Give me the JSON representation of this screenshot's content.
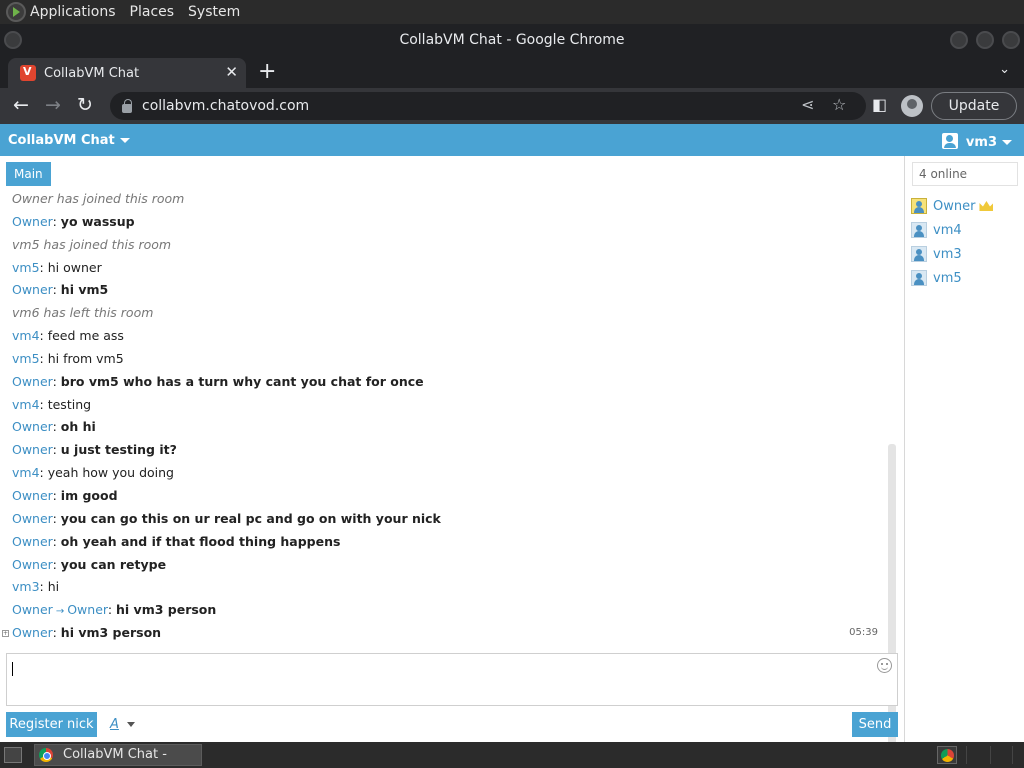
{
  "gnome_panel": {
    "menus": [
      "Applications",
      "Places",
      "System"
    ]
  },
  "window": {
    "title": "CollabVM Chat - Google Chrome"
  },
  "tab": {
    "title": "CollabVM Chat",
    "close": "✕",
    "new_tab": "+",
    "tab_menu": "⌄"
  },
  "toolbar": {
    "back": "←",
    "forward": "→",
    "reload": "↻",
    "url": "collabvm.chatovod.com",
    "share": "⋖",
    "bookmark": "☆",
    "sidepanel": "◧",
    "update_label": "Update"
  },
  "site_header": {
    "brand": "CollabVM Chat",
    "current_user": "vm3"
  },
  "chat": {
    "room_tab": "Main",
    "messages": [
      {
        "type": "system",
        "text": "Owner has joined this room"
      },
      {
        "type": "msg",
        "nick": "Owner",
        "text": "yo wassup",
        "bold": true
      },
      {
        "type": "system",
        "text": "vm5 has joined this room"
      },
      {
        "type": "msg",
        "nick": "vm5",
        "text": "hi owner",
        "bold": false
      },
      {
        "type": "msg",
        "nick": "Owner",
        "text": "hi vm5",
        "bold": true
      },
      {
        "type": "system",
        "text": "vm6 has left this room"
      },
      {
        "type": "msg",
        "nick": "vm4",
        "text": "feed me ass",
        "bold": false
      },
      {
        "type": "msg",
        "nick": "vm5",
        "text": "hi from vm5",
        "bold": false
      },
      {
        "type": "msg",
        "nick": "Owner",
        "text": "bro vm5 who has a turn why cant you chat for once",
        "bold": true
      },
      {
        "type": "msg",
        "nick": "vm4",
        "text": "testing",
        "bold": false
      },
      {
        "type": "msg",
        "nick": "Owner",
        "text": "oh hi",
        "bold": true
      },
      {
        "type": "msg",
        "nick": "Owner",
        "text": "u just testing it?",
        "bold": true
      },
      {
        "type": "msg",
        "nick": "vm4",
        "text": "yeah how you doing",
        "bold": false
      },
      {
        "type": "msg",
        "nick": "Owner",
        "text": "im good",
        "bold": true
      },
      {
        "type": "msg",
        "nick": "Owner",
        "text": "you can go this on ur real pc and go on with your nick",
        "bold": true
      },
      {
        "type": "msg",
        "nick": "Owner",
        "text": "oh yeah and if that flood thing happens",
        "bold": true
      },
      {
        "type": "msg",
        "nick": "Owner",
        "text": "you can retype",
        "bold": true
      },
      {
        "type": "msg",
        "nick": "vm3",
        "text": "hi",
        "bold": false
      },
      {
        "type": "private",
        "nick": "Owner",
        "to": "Owner",
        "text": "hi vm3 person",
        "bold": true
      },
      {
        "type": "msg",
        "nick": "Owner",
        "text": "hi vm3 person",
        "bold": true,
        "time": "05:39"
      }
    ],
    "register_label": "Register nick",
    "font_label": "A",
    "send_label": "Send"
  },
  "users": {
    "online_label": "4 online",
    "list": [
      {
        "name": "Owner",
        "role": "owner"
      },
      {
        "name": "vm4",
        "role": "user"
      },
      {
        "name": "vm3",
        "role": "user"
      },
      {
        "name": "vm5",
        "role": "user"
      }
    ]
  },
  "taskbar": {
    "task_title": "CollabVM Chat - Go..."
  },
  "colors": {
    "accent": "#4aa3d3",
    "nick": "#3d8fc4",
    "system_text": "#777777"
  }
}
